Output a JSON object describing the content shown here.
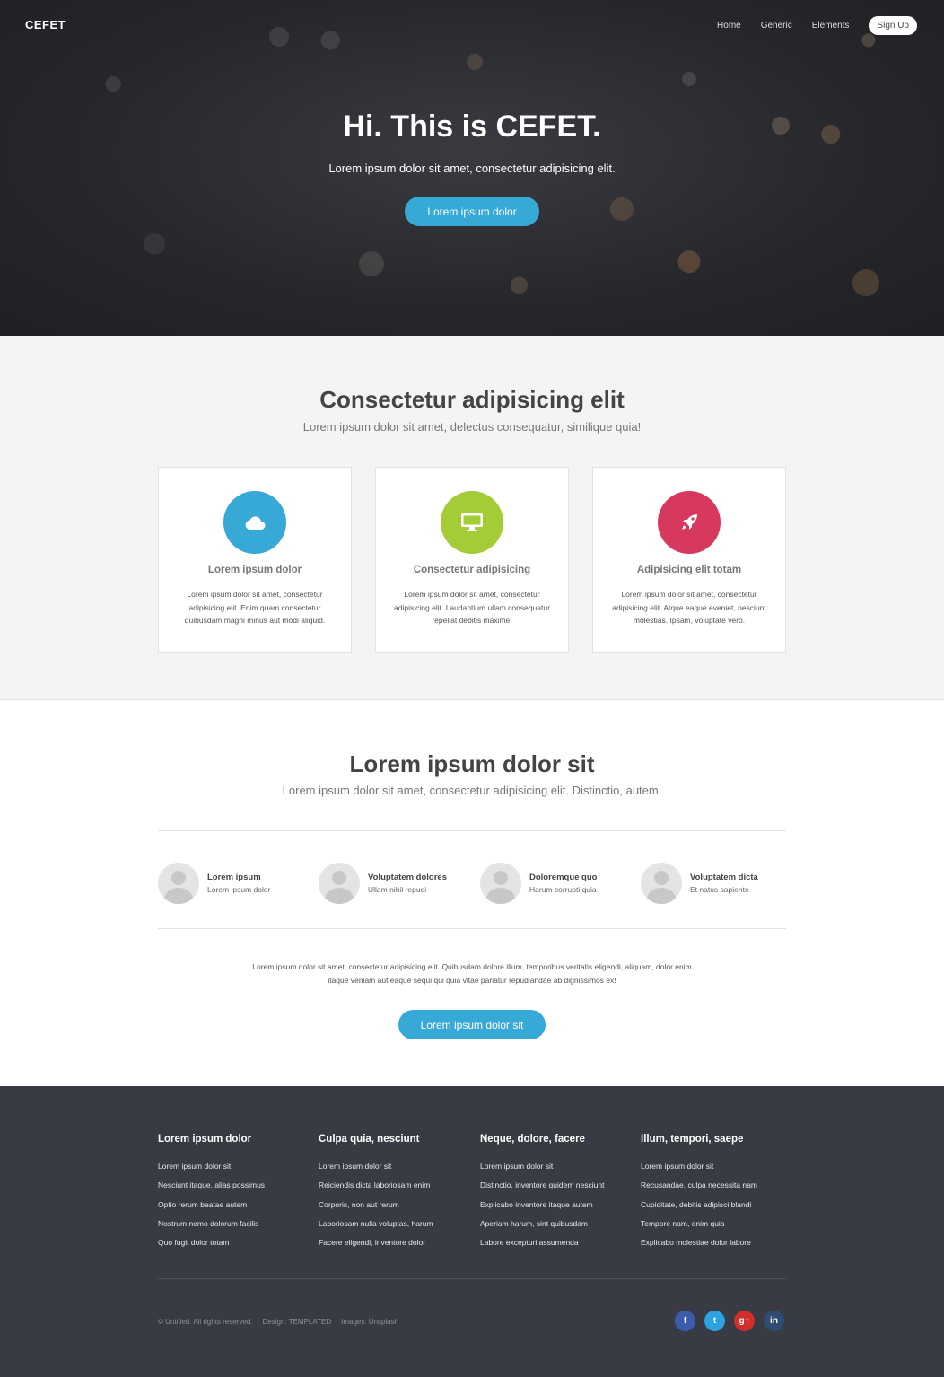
{
  "header": {
    "logo": "CEFET",
    "nav": [
      "Home",
      "Generic",
      "Elements"
    ],
    "signup": "Sign Up"
  },
  "hero": {
    "title": "Hi. This is CEFET.",
    "subtitle": "Lorem ipsum dolor sit amet, consectetur adipisicing elit.",
    "button": "Lorem ipsum dolor"
  },
  "features": {
    "title": "Consectetur adipisicing elit",
    "subtitle": "Lorem ipsum dolor sit amet, delectus consequatur, similique quia!",
    "cards": [
      {
        "icon": "cloud-icon",
        "color": "#36a9d6",
        "title": "Lorem ipsum dolor",
        "text": "Lorem ipsum dolor sit amet, consectetur adipisicing elit. Enim quam consectetur quibusdam magni minus aut modi aliquid."
      },
      {
        "icon": "desktop-icon",
        "color": "#a3cc36",
        "title": "Consectetur adipisicing",
        "text": "Lorem ipsum dolor sit amet, consectetur adipisicing elit. Laudantium ullam consequatur repellat debitis maxime."
      },
      {
        "icon": "rocket-icon",
        "color": "#d7395e",
        "title": "Adipisicing elit totam",
        "text": "Lorem ipsum dolor sit amet, consectetur adipisicing elit. Atque eaque eveniet, nesciunt molestias. Ipsam, voluptate vero."
      }
    ]
  },
  "team": {
    "title": "Lorem ipsum dolor sit",
    "subtitle": "Lorem ipsum dolor sit amet, consectetur adipisicing elit. Distinctio, autem.",
    "people": [
      {
        "name": "Lorem ipsum",
        "role": "Lorem ipsum dolor"
      },
      {
        "name": "Voluptatem dolores",
        "role": "Ullam nihil repudi"
      },
      {
        "name": "Doloremque quo",
        "role": "Harum corrupti quia"
      },
      {
        "name": "Voluptatem dicta",
        "role": "Et natus sapiente"
      }
    ],
    "paragraph": "Lorem ipsum dolor sit amet, consectetur adipisicing elit. Quibusdam dolore illum, temporibus veritatis eligendi, aliquam, dolor enim itaque veniam aut eaque sequi qui quia vitae pariatur repudiandae ab dignissimos ex!",
    "button": "Lorem ipsum dolor sit"
  },
  "footer": {
    "columns": [
      {
        "title": "Lorem ipsum dolor",
        "links": [
          "Lorem ipsum dolor sit",
          "Nesciunt itaque, alias possimus",
          "Optio rerum beatae autem",
          "Nostrum nemo dolorum facilis",
          "Quo fugit dolor totam"
        ]
      },
      {
        "title": "Culpa quia, nesciunt",
        "links": [
          "Lorem ipsum dolor sit",
          "Reiciendis dicta laboriosam enim",
          "Corporis, non aut rerum",
          "Laboriosam nulla voluptas, harum",
          "Facere eligendi, inventore dolor"
        ]
      },
      {
        "title": "Neque, dolore, facere",
        "links": [
          "Lorem ipsum dolor sit",
          "Distinctio, inventore quidem nesciunt",
          "Explicabo inventore itaque autem",
          "Aperiam harum, sint quibusdam",
          "Labore excepturi assumenda"
        ]
      },
      {
        "title": "Illum, tempori, saepe",
        "links": [
          "Lorem ipsum dolor sit",
          "Recusandae, culpa necessita nam",
          "Cupiditate, debitis adipisci blandi",
          "Tempore nam, enim quia",
          "Explicabo molestiae dolor labore"
        ]
      }
    ],
    "copyright": "© Untitled. All rights reserved.",
    "design": "Design: TEMPLATED",
    "images": "Images: Unsplash",
    "social": [
      {
        "icon": "facebook-icon",
        "glyph": "f",
        "color": "#3b5bab"
      },
      {
        "icon": "twitter-icon",
        "glyph": "t",
        "color": "#2aa3e0"
      },
      {
        "icon": "google-plus-icon",
        "glyph": "g+",
        "color": "#d1302a"
      },
      {
        "icon": "linkedin-icon",
        "glyph": "in",
        "color": "#2f4d72"
      }
    ]
  }
}
